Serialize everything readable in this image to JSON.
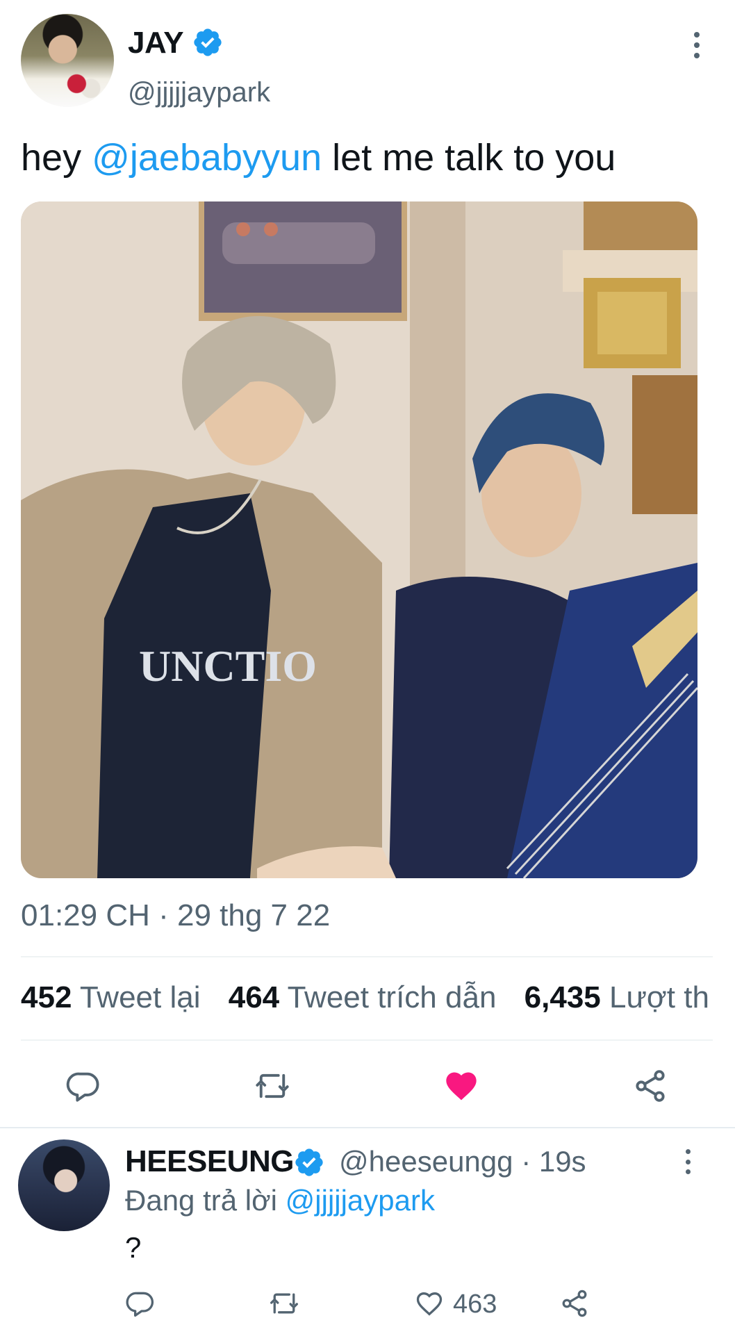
{
  "tweet": {
    "author": {
      "display_name": "JAY",
      "handle": "@jjjjjaypark",
      "verified": true
    },
    "text_parts": {
      "before": "hey ",
      "mention": "@jaebabyyun",
      "after": " let me talk to you"
    },
    "timestamp": "01:29 CH · 29 thg 7 22",
    "stats": {
      "retweets": {
        "count": "452",
        "label": "Tweet lại"
      },
      "quotes": {
        "count": "464",
        "label": "Tweet trích dẫn"
      },
      "likes": {
        "count": "6,435",
        "label": "Lượt th"
      }
    },
    "liked": true
  },
  "reply": {
    "author": {
      "display_name": "HEESEUNG",
      "handle": "@heeseungg",
      "verified": true
    },
    "time": "· 19s",
    "replying_prefix": "Đang trả lời ",
    "replying_mention": "@jjjjjaypark",
    "text": "?",
    "like_count": "463"
  },
  "icons": {
    "reply": "reply-icon",
    "retweet": "retweet-icon",
    "like": "heart-icon",
    "share": "share-icon",
    "more": "more-vertical-icon",
    "verified": "verified-badge-icon"
  },
  "colors": {
    "accent": "#1d9bf0",
    "like": "#f91880",
    "secondary_text": "#536471",
    "primary_text": "#0f1419"
  }
}
